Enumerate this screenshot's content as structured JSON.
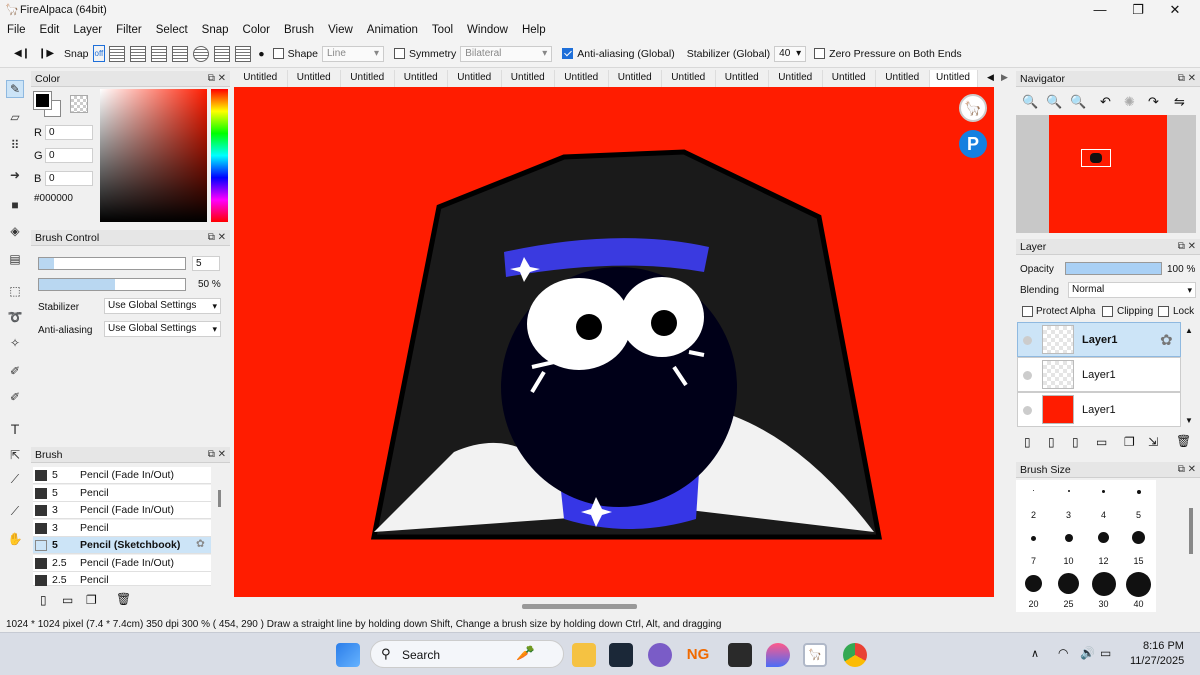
{
  "app": {
    "title": "FireAlpaca (64bit)"
  },
  "menu": [
    "File",
    "Edit",
    "Layer",
    "Filter",
    "Select",
    "Snap",
    "Color",
    "Brush",
    "View",
    "Animation",
    "Tool",
    "Window",
    "Help"
  ],
  "toolbar": {
    "snap_label": "Snap",
    "snap_off": "off",
    "shape_label": "Shape",
    "shape_value": "Line",
    "symmetry_label": "Symmetry",
    "symmetry_value": "Bilateral",
    "antialias_label": "Anti-aliasing (Global)",
    "stabilizer_label": "Stabilizer (Global)",
    "stabilizer_value": "40",
    "zero_pressure_label": "Zero Pressure on Both Ends"
  },
  "color_panel": {
    "title": "Color",
    "r_label": "R",
    "r": "0",
    "g_label": "G",
    "g": "0",
    "b_label": "B",
    "b": "0",
    "hex": "#000000"
  },
  "brush_control": {
    "title": "Brush Control",
    "size": "5",
    "opacity": "50 %",
    "stabilizer_label": "Stabilizer",
    "stabilizer_value": "Use Global Settings",
    "antialias_label": "Anti-aliasing",
    "antialias_value": "Use Global Settings"
  },
  "brush_panel": {
    "title": "Brush",
    "items": [
      {
        "size": "5",
        "name": "Pencil (Fade In/Out)"
      },
      {
        "size": "5",
        "name": "Pencil"
      },
      {
        "size": "3",
        "name": "Pencil (Fade In/Out)"
      },
      {
        "size": "3",
        "name": "Pencil"
      },
      {
        "size": "5",
        "name": "Pencil (Sketchbook)"
      },
      {
        "size": "2.5",
        "name": "Pencil (Fade In/Out)"
      },
      {
        "size": "2.5",
        "name": "Pencil"
      }
    ],
    "selected_index": 4
  },
  "tabs": [
    "Untitled",
    "Untitled",
    "Untitled",
    "Untitled",
    "Untitled",
    "Untitled",
    "Untitled",
    "Untitled",
    "Untitled",
    "Untitled",
    "Untitled",
    "Untitled",
    "Untitled",
    "Untitled"
  ],
  "navigator": {
    "title": "Navigator"
  },
  "layer_panel": {
    "title": "Layer",
    "opacity_label": "Opacity",
    "opacity_value": "100 %",
    "opacity_fraction": 1.0,
    "blending_label": "Blending",
    "blending_value": "Normal",
    "protect_alpha": "Protect Alpha",
    "clipping": "Clipping",
    "lock": "Lock",
    "layers": [
      {
        "name": "Layer1"
      },
      {
        "name": "Layer1"
      },
      {
        "name": "Layer1"
      }
    ]
  },
  "brush_size": {
    "title": "Brush Size",
    "sizes": [
      "1",
      "1.5",
      "2",
      "3",
      "5",
      "7",
      "10",
      "12",
      "15",
      "20",
      "25",
      "30",
      "40"
    ],
    "labels_visible": [
      "2",
      "3",
      "4",
      "5",
      "7",
      "10",
      "12",
      "15",
      "20",
      "25",
      "30",
      "40"
    ]
  },
  "status": "1024 * 1024 pixel   (7.4 * 7.4cm)   350 dpi   300 %   ( 454, 290 )   Draw a straight line by holding down Shift, Change a brush size by holding down Ctrl, Alt, and dragging",
  "taskbar": {
    "search": "Search",
    "time": "8:16 PM",
    "date": "11/27/2025"
  },
  "colors": {
    "canvas_bg": "#ff1c00",
    "accent": "#1e6fd9",
    "selection": "#cce4f7"
  }
}
